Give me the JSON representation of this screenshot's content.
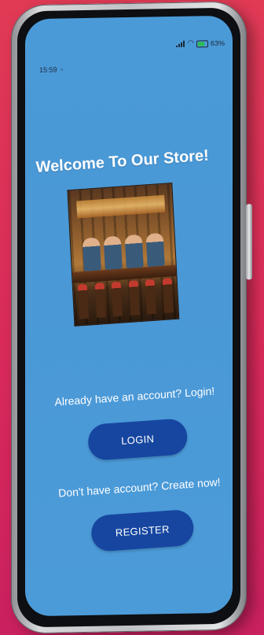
{
  "status_bar": {
    "time": "15:59",
    "battery": "63%"
  },
  "main": {
    "title": "Welcome To Our Store!",
    "login_prompt": "Already have an account? Login!",
    "login_button": "LOGIN",
    "register_prompt": "Don't have account? Create now!",
    "register_button": "REGISTER"
  },
  "colors": {
    "screen_background": "#4b9ad8",
    "button": "#1646a0",
    "page_background": "#e03a55"
  }
}
